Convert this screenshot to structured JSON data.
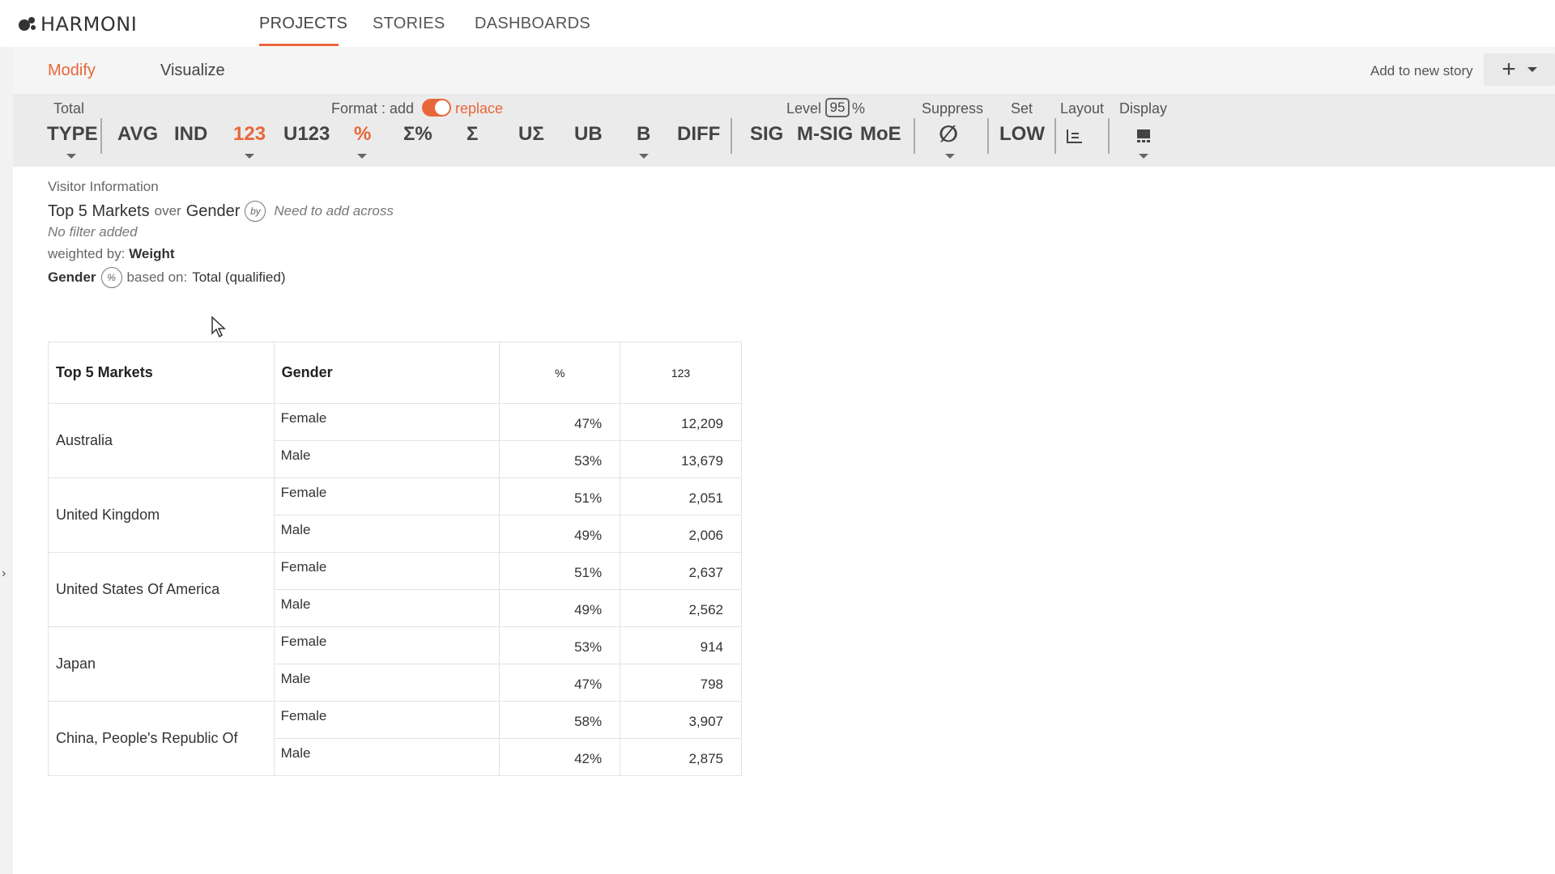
{
  "app": {
    "brand": "HARMONI",
    "brand_icon": "harmoni-logo-icon"
  },
  "nav": {
    "projects": "PROJECTS",
    "stories": "STORIES",
    "dashboards": "DASHBOARDS",
    "active": "PROJECTS"
  },
  "subnav": {
    "modify": "Modify",
    "visualize": "Visualize",
    "add_story": "Add to new story",
    "add_icon": "plus-icon"
  },
  "toolbar": {
    "total_label": "Total",
    "type": "TYPE",
    "avg": "AVG",
    "ind": "IND",
    "n123": "123",
    "u123": "U123",
    "pct": "%",
    "sigma_pct": "Σ%",
    "sigma": "Σ",
    "u_sigma": "UΣ",
    "ub": "UB",
    "b": "B",
    "diff": "DIFF",
    "format_label": "Format : add",
    "replace_label": "replace",
    "level_label": "Level",
    "level_value": "95",
    "level_pct": "%",
    "sig": "SIG",
    "msig": "M-SIG",
    "moe": "MoE",
    "suppress_label": "Suppress",
    "suppress_icon": "∅",
    "set_label": "Set",
    "set_value": "LOW",
    "layout_label": "Layout",
    "display_label": "Display",
    "accent": "#e8673a"
  },
  "info": {
    "section": "Visitor Information",
    "row_var": "Top 5 Markets",
    "over": "over",
    "col_var": "Gender",
    "by_badge": "by",
    "need": "Need to add across",
    "filter": "No filter added",
    "weighted_label": "weighted by:",
    "weighted_value": "Weight",
    "pct_var": "Gender",
    "pct_badge": "%",
    "based_label": "based on:",
    "based_value": "Total (qualified)"
  },
  "table": {
    "headers": {
      "market": "Top 5 Markets",
      "gender": "Gender",
      "pct": "%",
      "count": "123"
    },
    "groups": [
      {
        "market": "Australia",
        "rows": [
          {
            "gender": "Female",
            "pct": "47%",
            "count": "12,209"
          },
          {
            "gender": "Male",
            "pct": "53%",
            "count": "13,679"
          }
        ]
      },
      {
        "market": "United Kingdom",
        "rows": [
          {
            "gender": "Female",
            "pct": "51%",
            "count": "2,051"
          },
          {
            "gender": "Male",
            "pct": "49%",
            "count": "2,006"
          }
        ]
      },
      {
        "market": "United States Of America",
        "rows": [
          {
            "gender": "Female",
            "pct": "51%",
            "count": "2,637"
          },
          {
            "gender": "Male",
            "pct": "49%",
            "count": "2,562"
          }
        ]
      },
      {
        "market": "Japan",
        "rows": [
          {
            "gender": "Female",
            "pct": "53%",
            "count": "914"
          },
          {
            "gender": "Male",
            "pct": "47%",
            "count": "798"
          }
        ]
      },
      {
        "market": "China, People's Republic Of",
        "rows": [
          {
            "gender": "Female",
            "pct": "58%",
            "count": "3,907"
          },
          {
            "gender": "Male",
            "pct": "42%",
            "count": "2,875"
          }
        ]
      }
    ]
  }
}
